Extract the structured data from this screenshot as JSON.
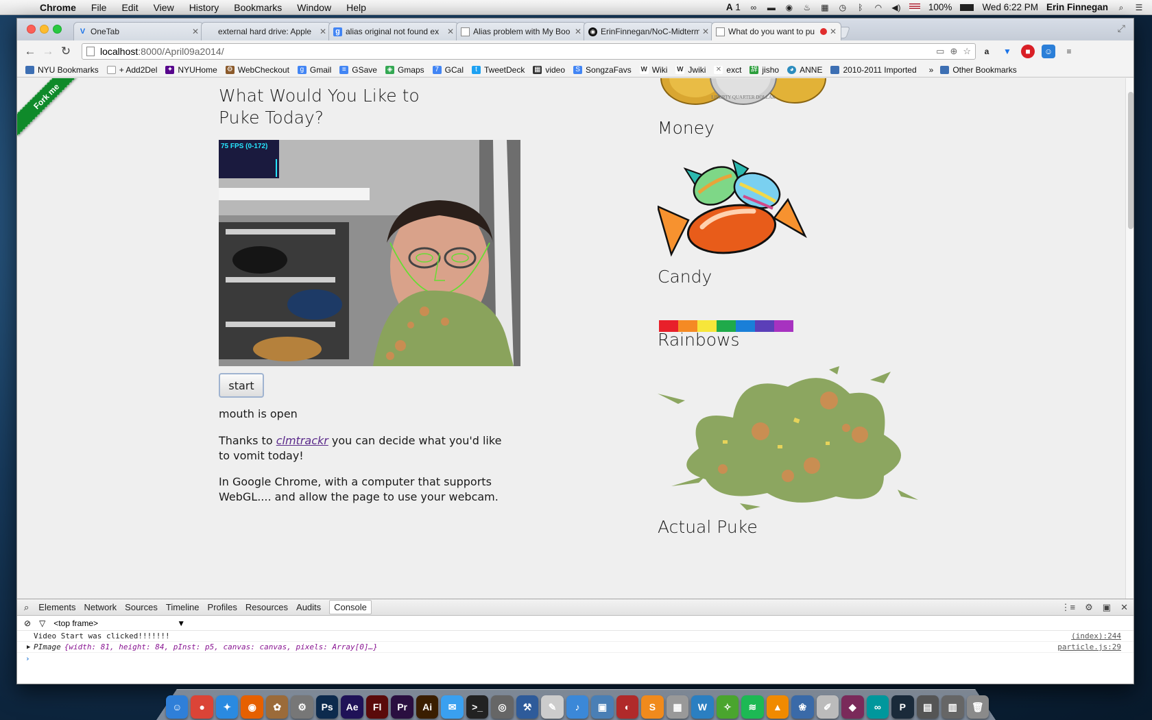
{
  "menubar": {
    "app_name": "Chrome",
    "menus": [
      "File",
      "Edit",
      "View",
      "History",
      "Bookmarks",
      "Window",
      "Help"
    ],
    "battery": "100%",
    "clock": "Wed 6:22 PM",
    "user": "Erin Finnegan",
    "input_badge": "1"
  },
  "tabs": [
    {
      "title": "OneTab",
      "icon": "onetab-icon",
      "color": "#1a73e8"
    },
    {
      "title": "external hard drive: Apple",
      "icon": "apple-icon",
      "color": "#555555"
    },
    {
      "title": "alias original not found ex",
      "icon": "google-icon",
      "color": "#4285f4"
    },
    {
      "title": "Alias problem with My Boo",
      "icon": "page-icon",
      "color": "#888888"
    },
    {
      "title": "ErinFinnegan/NoC-Midterm",
      "icon": "github-icon",
      "color": "#111111"
    },
    {
      "title": "What do you want to pu",
      "icon": "page-icon",
      "color": "#888888"
    }
  ],
  "address_bar": {
    "host": "localhost",
    "path": ":8000/April09a2014/"
  },
  "bookmarks": [
    {
      "label": "NYU Bookmarks",
      "icon": "folder-icon",
      "color": "#3d6fb3"
    },
    {
      "label": "+ Add2Del",
      "icon": "page-icon",
      "color": "#999999"
    },
    {
      "label": "NYUHome",
      "icon": "nyu-icon",
      "color": "#57068c"
    },
    {
      "label": "WebCheckout",
      "icon": "webcheckout-icon",
      "color": "#8b5a2b"
    },
    {
      "label": "Gmail",
      "icon": "google-icon",
      "color": "#4285f4"
    },
    {
      "label": "GSave",
      "icon": "gsave-icon",
      "color": "#4285f4"
    },
    {
      "label": "Gmaps",
      "icon": "maps-icon",
      "color": "#34a853"
    },
    {
      "label": "GCal",
      "icon": "calendar-icon",
      "color": "#4285f4"
    },
    {
      "label": "TweetDeck",
      "icon": "tweetdeck-icon",
      "color": "#1da1f2"
    },
    {
      "label": "video",
      "icon": "video-icon",
      "color": "#333333"
    },
    {
      "label": "SongzaFavs",
      "icon": "google-icon",
      "color": "#4285f4"
    },
    {
      "label": "Wiki",
      "icon": "wikipedia-icon",
      "color": "#333333"
    },
    {
      "label": "Jwiki",
      "icon": "wikipedia-icon",
      "color": "#333333"
    },
    {
      "label": "exct",
      "icon": "exct-icon",
      "color": "#777777"
    },
    {
      "label": "jisho",
      "icon": "jisho-icon",
      "color": "#2a9d3a"
    },
    {
      "label": "ANNE",
      "icon": "anne-icon",
      "color": "#2b8cbe"
    },
    {
      "label": "2010-2011 Imported",
      "icon": "folder-icon",
      "color": "#3d6fb3"
    }
  ],
  "bookmarks_overflow": "»",
  "other_bookmarks": "Other Bookmarks",
  "page": {
    "ribbon": "Fork me",
    "heading": "What Would You Like to Puke Today?",
    "fps_label": "75 FPS (0-172)",
    "start_button": "start",
    "status": "mouth is open",
    "para1_prefix": "Thanks to ",
    "para1_link": "clmtrackr",
    "para1_suffix": " you can decide what you'd like to vomit today!",
    "para2": "In Google Chrome, with a computer that supports WebGL.... and allow the page to use your webcam.",
    "sections": [
      "Money",
      "Candy",
      "Rainbows",
      "Actual Puke"
    ],
    "rainbow_colors": [
      "#e8202a",
      "#f58a24",
      "#f7e63a",
      "#1faa4a",
      "#1a7fd8",
      "#5b3fb8",
      "#a732c0"
    ],
    "coin_text": "LIBERTY  QUARTER DOLLAR"
  },
  "devtools": {
    "tabs": [
      "Elements",
      "Network",
      "Sources",
      "Timeline",
      "Profiles",
      "Resources",
      "Audits",
      "Console"
    ],
    "frame_selector": "<top frame>",
    "log1": "Video Start was clicked!!!!!!!",
    "log1_src": "(index):244",
    "log2_type": "PImage",
    "log2_fields": "{width: 81, height: 84, pInst: p5, canvas: canvas, pixels: Array[0]…}",
    "log2_src": "particle.js:29",
    "prompt": "›"
  },
  "dock": [
    {
      "icon": "finder-icon",
      "glyph": "☺",
      "color": "#2f7fd8"
    },
    {
      "icon": "chrome-icon",
      "glyph": "●",
      "color": "#db4437"
    },
    {
      "icon": "safari-icon",
      "glyph": "✦",
      "color": "#2a8ae0"
    },
    {
      "icon": "firefox-icon",
      "glyph": "◉",
      "color": "#e66000"
    },
    {
      "icon": "squirrel-icon",
      "glyph": "✿",
      "color": "#9b6b3a"
    },
    {
      "icon": "system-prefs-icon",
      "glyph": "⚙",
      "color": "#777777"
    },
    {
      "icon": "photoshop-icon",
      "glyph": "Ps",
      "color": "#0c2a4d"
    },
    {
      "icon": "after-effects-icon",
      "glyph": "Ae",
      "color": "#1f1257"
    },
    {
      "icon": "flash-icon",
      "glyph": "Fl",
      "color": "#5a0a0a"
    },
    {
      "icon": "premiere-icon",
      "glyph": "Pr",
      "color": "#2a0f40"
    },
    {
      "icon": "illustrator-icon",
      "glyph": "Ai",
      "color": "#3a1e00"
    },
    {
      "icon": "messages-icon",
      "glyph": "✉",
      "color": "#3aa0f0"
    },
    {
      "icon": "terminal-icon",
      "glyph": ">_",
      "color": "#222222"
    },
    {
      "icon": "camera-icon",
      "glyph": "◎",
      "color": "#666666"
    },
    {
      "icon": "xcode-icon",
      "glyph": "⚒",
      "color": "#2e5b9a"
    },
    {
      "icon": "textedit-icon",
      "glyph": "✎",
      "color": "#cccccc"
    },
    {
      "icon": "itunes-icon",
      "glyph": "♪",
      "color": "#3b88d8"
    },
    {
      "icon": "preview-icon",
      "glyph": "▣",
      "color": "#4a7fb5"
    },
    {
      "icon": "photobooth-icon",
      "glyph": "◐",
      "color": "#b02a2a"
    },
    {
      "icon": "sublime-icon",
      "glyph": "S",
      "color": "#f08a1c"
    },
    {
      "icon": "calculator-icon",
      "glyph": "▦",
      "color": "#999999"
    },
    {
      "icon": "wunderlist-icon",
      "glyph": "W",
      "color": "#2b7fc1"
    },
    {
      "icon": "evernote-icon",
      "glyph": "✧",
      "color": "#4aa52e"
    },
    {
      "icon": "spotify-icon",
      "glyph": "≋",
      "color": "#1db954"
    },
    {
      "icon": "vlc-icon",
      "glyph": "▲",
      "color": "#f08a00"
    },
    {
      "icon": "iphoto-icon",
      "glyph": "❀",
      "color": "#3a6aa8"
    },
    {
      "icon": "pencil-icon",
      "glyph": "✐",
      "color": "#bbbbbb"
    },
    {
      "icon": "app-icon",
      "glyph": "◆",
      "color": "#7a2a5a"
    },
    {
      "icon": "arduino-icon",
      "glyph": "∞",
      "color": "#00979c"
    },
    {
      "icon": "processing-icon",
      "glyph": "P",
      "color": "#1a2a3a"
    },
    {
      "icon": "finder-window-icon",
      "glyph": "▤",
      "color": "#555555"
    },
    {
      "icon": "downloads-icon",
      "glyph": "▥",
      "color": "#666666"
    },
    {
      "icon": "trash-icon",
      "glyph": "🗑",
      "color": "#8a8a8a"
    }
  ]
}
